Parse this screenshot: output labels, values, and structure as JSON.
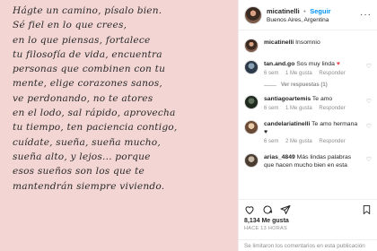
{
  "photo": {
    "lines": [
      "Hágte un camino, písalo bien.",
      "Sé fiel en lo que crees,",
      "en lo que piensas, fortalece",
      "tu filosofía de vida, encuentra",
      "personas que combinen con tu",
      "mente, elige corazones sanos,",
      "ve perdonando, no te atores",
      "en el lodo, sal rápido, aprovecha",
      "tu tiempo, ten paciencia contigo,",
      "cuídate, sueña, sueña mucho,",
      "sueña alto, y lejos... porque",
      "esos sueños son los que te",
      "mantendrán siempre viviendo."
    ]
  },
  "header": {
    "username": "micatinelli",
    "dot": "•",
    "follow": "Seguir",
    "location": "Buenos Aires, Argentina",
    "more": "···"
  },
  "caption": {
    "username": "micatinelli",
    "text": "Insomnio"
  },
  "comments": [
    {
      "username": "tan.and.go",
      "text": "Sos muy linda",
      "time": "6 sem",
      "likes": "1 Me gusta",
      "reply": "Responder"
    },
    {
      "username": "santiagoartemis",
      "text": "Te amo",
      "time": "6 sem",
      "likes": "1 Me gusta",
      "reply": "Responder"
    },
    {
      "username": "candelariatinelli",
      "text": "Te amo hermana",
      "time": "6 sem",
      "likes": "2 Me gusta",
      "reply": "Responder"
    },
    {
      "username": "arias_4849",
      "text": "Más lindas palabras que hacen mucho bien en esta",
      "time": "",
      "likes": "",
      "reply": ""
    }
  ],
  "replies_link": "Ver respuestas (1)",
  "likes": "8,134 Me gusta",
  "time_ago": "HACE 13 HORAS",
  "limit_notice": "Se limitaron los comentarios en esta publicación",
  "colors": {
    "accent": "#0095f6",
    "heart_red": "#ed4956",
    "photo_bg": "#f3d6d4"
  },
  "icons": [
    "heart-icon",
    "comment-icon",
    "share-icon",
    "bookmark-icon"
  ]
}
